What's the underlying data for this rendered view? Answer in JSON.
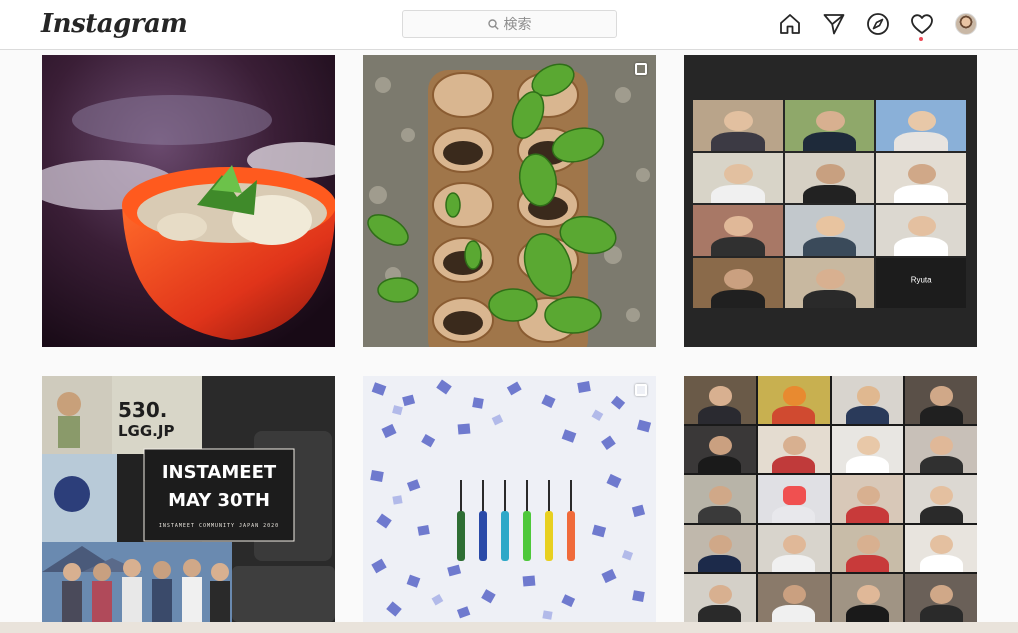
{
  "header": {
    "logo_text": "Instagram",
    "search": {
      "placeholder": "検索"
    },
    "nav_icons": [
      "home-icon",
      "direct-message-icon",
      "explore-icon",
      "activity-heart-icon",
      "profile-avatar"
    ]
  },
  "posts": [
    {
      "subject": "red bowl of soup with vegetables",
      "multi_image": false
    },
    {
      "subject": "seedlings growing in eggshells",
      "multi_image": true
    },
    {
      "subject": "video call grid",
      "multi_image": false,
      "tile_label": "Ryuta"
    },
    {
      "subject": "instameet poster",
      "multi_image": false,
      "poster": {
        "badge_line1": "530.",
        "badge_line2": "LGG.JP",
        "title_line1": "INSTAMEET",
        "title_line2": "MAY 30TH",
        "subtitle": "INSTAMEET COMMUNITY JAPAN 2020"
      }
    },
    {
      "subject": "colored screwdrivers on hydrangea petals",
      "multi_image": true
    },
    {
      "subject": "video call grid",
      "multi_image": false
    }
  ],
  "colors": {
    "background": "#fafafa",
    "header_bg": "#ffffff",
    "border": "#dbdbdb",
    "notification_dot": "#ed4956",
    "text": "#262626",
    "muted": "#8e8e8e"
  }
}
